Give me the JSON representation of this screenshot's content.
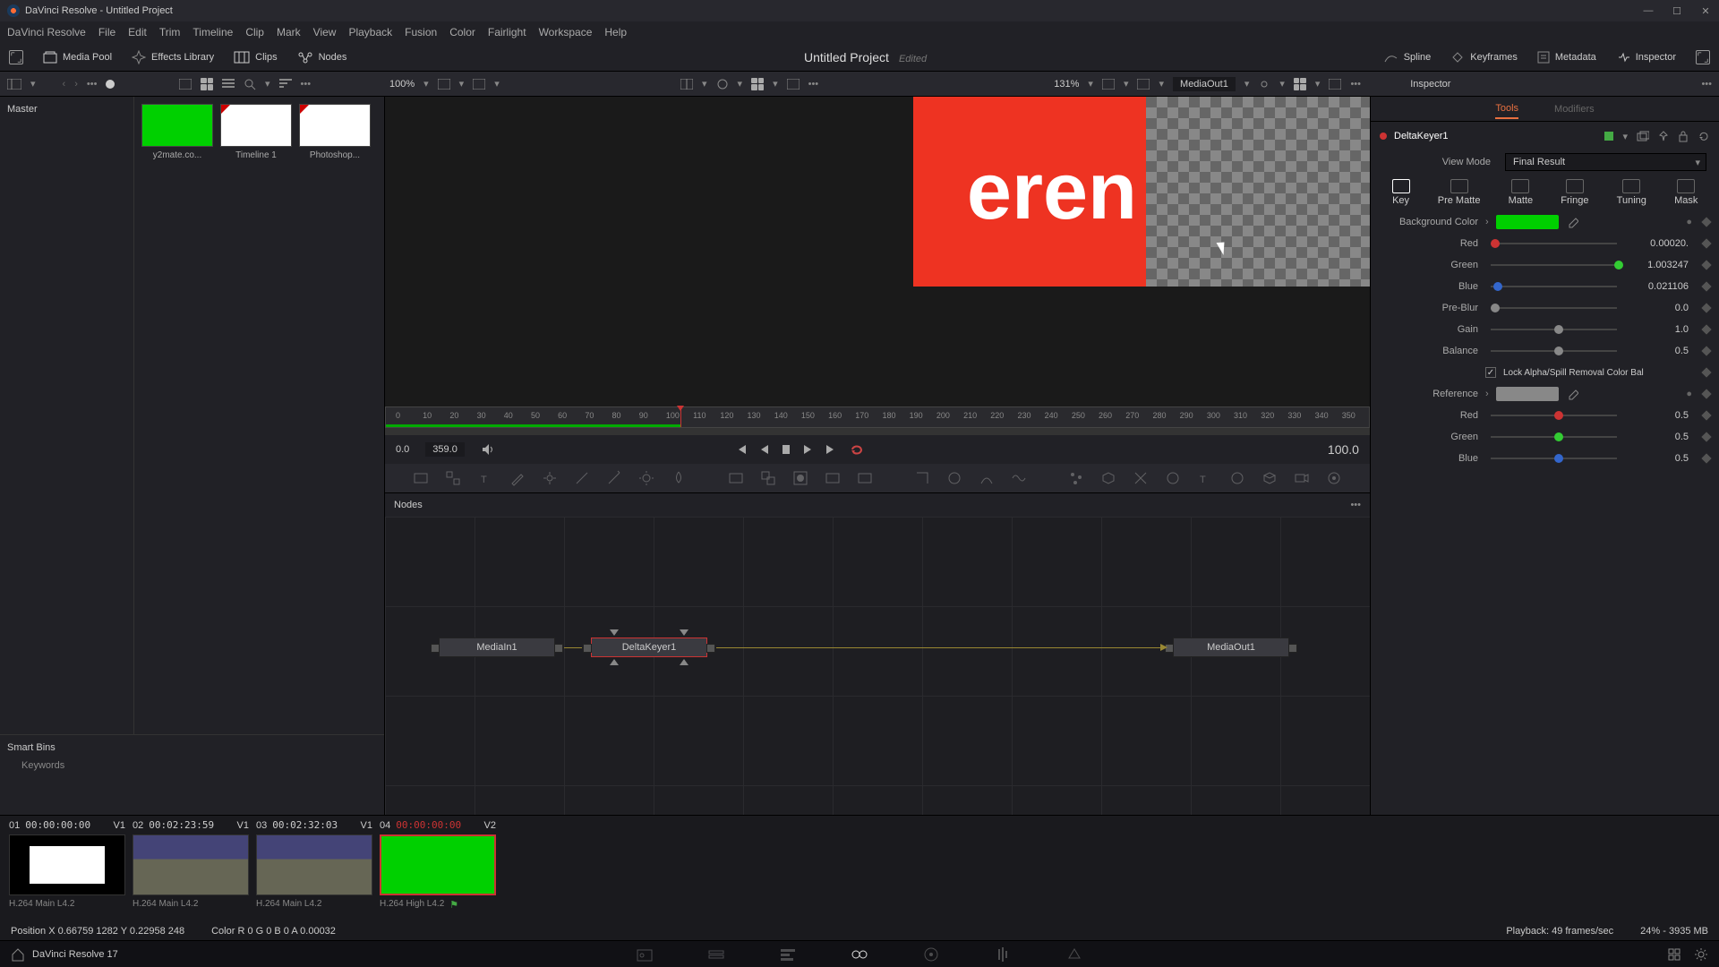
{
  "titlebar": {
    "title": "DaVinci Resolve - Untitled Project"
  },
  "menubar": [
    "DaVinci Resolve",
    "File",
    "Edit",
    "Trim",
    "Timeline",
    "Clip",
    "Mark",
    "View",
    "Playback",
    "Fusion",
    "Color",
    "Fairlight",
    "Workspace",
    "Help"
  ],
  "toolbar1": {
    "media_pool": "Media Pool",
    "effects": "Effects Library",
    "clips": "Clips",
    "nodes": "Nodes",
    "project": "Untitled Project",
    "edited": "Edited",
    "spline": "Spline",
    "keyframes": "Keyframes",
    "metadata": "Metadata",
    "inspector": "Inspector"
  },
  "toolbar2": {
    "zoom1": "100%",
    "zoom2": "131%",
    "mediaout": "MediaOut1",
    "inspector": "Inspector"
  },
  "media": {
    "master": "Master",
    "thumbs": [
      {
        "label": "y2mate.co..."
      },
      {
        "label": "Timeline 1"
      },
      {
        "label": "Photoshop..."
      }
    ],
    "smart_bins": "Smart Bins",
    "keywords": "Keywords"
  },
  "viewer": {
    "text": "eren",
    "time_start": "0.0",
    "time_cur": "359.0",
    "time_end": "100.0",
    "ticks": [
      "0",
      "10",
      "20",
      "30",
      "40",
      "50",
      "60",
      "70",
      "80",
      "90",
      "100",
      "110",
      "120",
      "130",
      "140",
      "150",
      "160",
      "170",
      "180",
      "190",
      "200",
      "210",
      "220",
      "230",
      "240",
      "250",
      "260",
      "270",
      "280",
      "290",
      "300",
      "310",
      "320",
      "330",
      "340",
      "350"
    ]
  },
  "nodes": {
    "title": "Nodes",
    "items": [
      "MediaIn1",
      "DeltaKeyer1",
      "MediaOut1"
    ]
  },
  "inspector": {
    "tab_tools": "Tools",
    "tab_mods": "Modifiers",
    "node": "DeltaKeyer1",
    "viewmode_lbl": "View Mode",
    "viewmode_val": "Final Result",
    "tabs": [
      "Key",
      "Pre Matte",
      "Matte",
      "Fringe",
      "Tuning",
      "Mask"
    ],
    "bg_color": "Background Color",
    "ref": "Reference",
    "lock": "Lock Alpha/Spill Removal Color Bal",
    "params": {
      "red": "Red",
      "green": "Green",
      "blue": "Blue",
      "preblur": "Pre-Blur",
      "gain": "Gain",
      "balance": "Balance"
    },
    "vals": {
      "bg_red": "0.00020.",
      "bg_green": "1.003247",
      "bg_blue": "0.021106",
      "preblur": "0.0",
      "gain": "1.0",
      "balance": "0.5",
      "ref_red": "0.5",
      "ref_green": "0.5",
      "ref_blue": "0.5"
    }
  },
  "clips": [
    {
      "n": "01",
      "tc": "00:00:00:00",
      "track": "V1",
      "codec": "H.264 Main L4.2"
    },
    {
      "n": "02",
      "tc": "00:02:23:59",
      "track": "V1",
      "codec": "H.264 Main L4.2"
    },
    {
      "n": "03",
      "tc": "00:02:32:03",
      "track": "V1",
      "codec": "H.264 Main L4.2"
    },
    {
      "n": "04",
      "tc": "00:00:00:00",
      "track": "V2",
      "codec": "H.264 High L4.2"
    }
  ],
  "status": {
    "pos": "Position  X  0.66759    1282    Y  0.22958    248",
    "color": "Color   R  0          G  0          B  0          A  0.00032",
    "playback": "Playback: 49 frames/sec",
    "mem": "24% - 3935 MB"
  },
  "footer": {
    "app": "DaVinci Resolve 17"
  }
}
